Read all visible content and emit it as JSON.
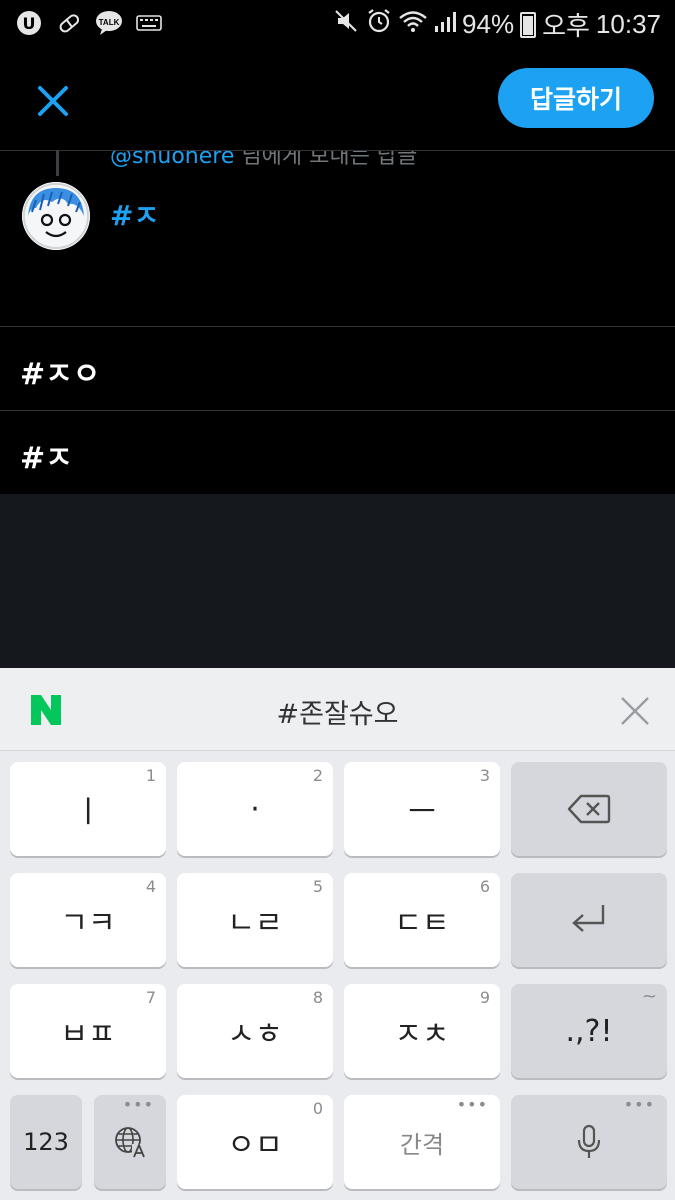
{
  "status": {
    "battery": "94%",
    "ampm": "오후",
    "time": "10:37",
    "left_icons": [
      "uplus-icon",
      "pill-icon",
      "kakaotalk-icon",
      "keyboard-icon"
    ],
    "talk_label": "TALK"
  },
  "header": {
    "reply_button": "답글하기"
  },
  "replying": {
    "handle": "@shuohere",
    "rest": " 님에게 보내는 답글"
  },
  "compose": {
    "text": "#ㅈ"
  },
  "suggestions": [
    "#ㅈㅇ",
    "#ㅈ"
  ],
  "keyboard": {
    "suggestion": "#존잘슈오",
    "rows": [
      [
        {
          "label": "ㅣ",
          "num": "1"
        },
        {
          "label": "·",
          "num": "2"
        },
        {
          "label": "ㅡ",
          "num": "3"
        }
      ],
      [
        {
          "label": "ㄱㅋ",
          "num": "4"
        },
        {
          "label": "ㄴㄹ",
          "num": "5"
        },
        {
          "label": "ㄷㅌ",
          "num": "6"
        }
      ],
      [
        {
          "label": "ㅂㅍ",
          "num": "7"
        },
        {
          "label": "ㅅㅎ",
          "num": "8"
        },
        {
          "label": "ㅈㅊ",
          "num": "9"
        }
      ]
    ],
    "punct": ".,?!",
    "tilde": "~",
    "numbers_key": "123",
    "zero_key": {
      "label": "ㅇㅁ",
      "num": "0"
    },
    "space_key": "간격",
    "dots": "•••",
    "colors": {
      "accent": "#1da1f2",
      "naver": "#03c75a"
    }
  }
}
